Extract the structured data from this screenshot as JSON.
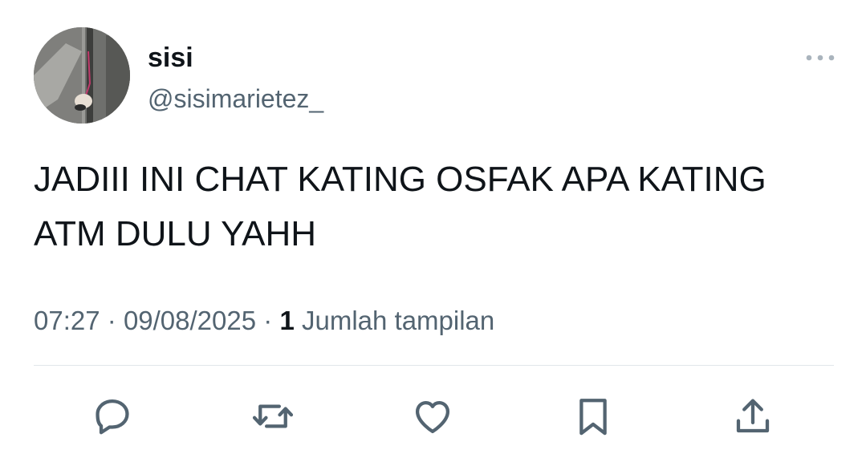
{
  "tweet": {
    "display_name": "sisi",
    "handle": "@sisimarietez_",
    "text": "JADIII INI CHAT KATING OSFAK APA KATING ATM DULU YAHH",
    "time": "07:27",
    "date": "09/08/2025",
    "separator": "·",
    "views_count": "1",
    "views_label": "Jumlah tampilan"
  },
  "icons": {
    "more": "more-horizontal-icon",
    "reply": "reply-icon",
    "retweet": "retweet-icon",
    "like": "heart-icon",
    "bookmark": "bookmark-icon",
    "share": "share-icon"
  },
  "colors": {
    "text_primary": "#0f1419",
    "text_secondary": "#536471",
    "icon": "#536471",
    "divider": "#e1e6ea"
  }
}
